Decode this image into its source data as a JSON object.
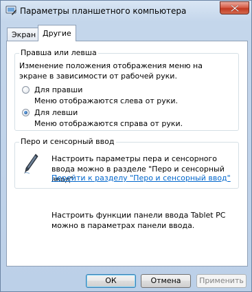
{
  "window": {
    "title": "Параметры планшетного компьютера",
    "close_glyph": "✕"
  },
  "tabs": [
    {
      "label": "Экран",
      "active": false
    },
    {
      "label": "Другие",
      "active": true
    }
  ],
  "handedness": {
    "group_title": "Правша или левша",
    "description": "Изменение положения отображения меню на экране в зависимости от рабочей руки.",
    "options": [
      {
        "label": "Для правши",
        "hint": "Меню отображаются слева от руки.",
        "selected": false
      },
      {
        "label": "Для левши",
        "hint": "Меню отображаются справа от руки.",
        "selected": true
      }
    ]
  },
  "pen": {
    "group_title": "Перо и сенсорный ввод",
    "description": "Настроить параметры пера и сенсорного ввода можно в разделе \"Перо и сенсорный ввод\".",
    "link": "Перейти к разделу \"Перо и сенсорный ввод\"",
    "icon": "pen-icon"
  },
  "input_panel_note": "Настроить функции панели ввода Tablet PC можно в параметрах панели ввода.",
  "buttons": {
    "ok": "ОК",
    "cancel": "Отмена",
    "apply": "Применить"
  },
  "colors": {
    "link": "#0066cc",
    "close_button": "#c23a22"
  }
}
